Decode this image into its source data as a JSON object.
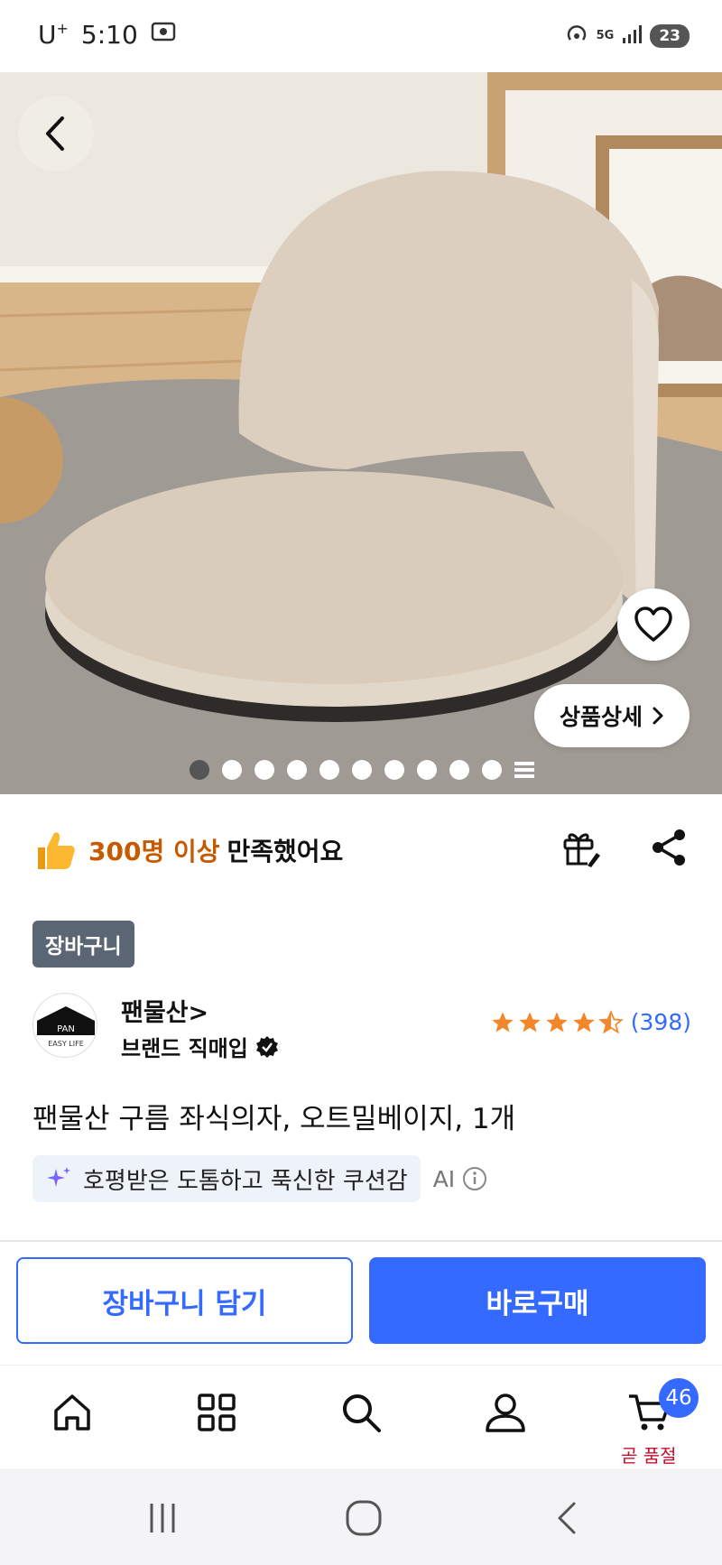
{
  "status_bar": {
    "carrier": "U",
    "carrier_sup": "+",
    "time": "5:10",
    "network": "5G",
    "battery": "23"
  },
  "hero": {
    "detail_button_label": "상품상세",
    "image_count_dots": 10,
    "active_dot": 0
  },
  "satisfaction": {
    "highlight": "300명 이상",
    "rest": "만족했어요"
  },
  "badge": {
    "label": "장바구니"
  },
  "brand": {
    "name": "팬물산>",
    "sub_label": "브랜드 직매입",
    "logo_text_top": "PAN",
    "logo_text_bottom": "EASY LIFE"
  },
  "rating": {
    "stars": 4.5,
    "count": "(398)"
  },
  "product": {
    "title": "팬물산 구름 좌식의자, 오트밀베이지, 1개"
  },
  "ai_summary": {
    "text": "호평받은 도톰하고 푹신한 쿠션감",
    "label": "AI"
  },
  "actions": {
    "add_to_cart": "장바구니 담기",
    "buy_now": "바로구매"
  },
  "bottom_nav": {
    "items": [
      "home-icon",
      "categories-icon",
      "search-icon",
      "my-account-icon",
      "cart-icon"
    ],
    "cart_badge": "46",
    "cart_label": "곧 품절"
  },
  "colors": {
    "accent": "#346aff",
    "highlight": "#c75a00",
    "badge_bg": "#5b6675",
    "soldout": "#c8102e"
  }
}
